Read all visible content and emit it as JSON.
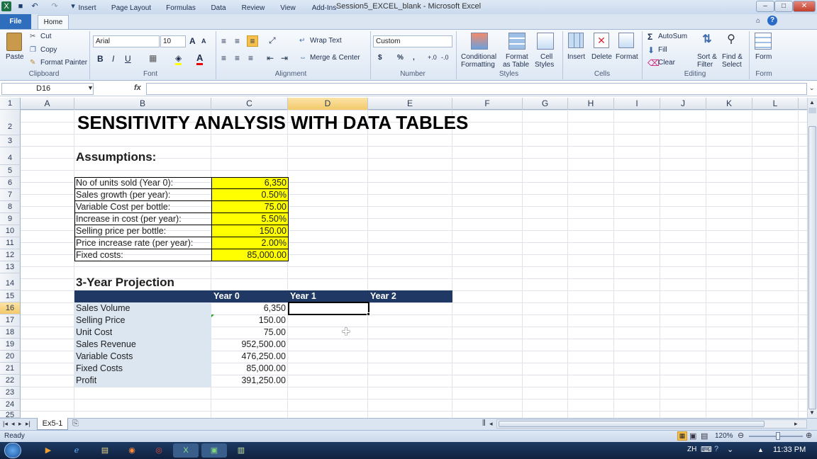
{
  "window": {
    "title": "Session5_EXCEL_blank - Microsoft Excel",
    "min": "–",
    "max": "□",
    "close": "✕"
  },
  "qat": {
    "app": "X",
    "save": "■",
    "undo": "↶",
    "redo": "↷",
    "customize": "▾"
  },
  "tabs": [
    "File",
    "Home",
    "Insert",
    "Page Layout",
    "Formulas",
    "Data",
    "Review",
    "View",
    "Add-Ins"
  ],
  "ribbon": {
    "clipboard": {
      "paste": "Paste",
      "cut": "Cut",
      "copy": "Copy",
      "format_painter": "Format Painter",
      "label": "Clipboard"
    },
    "font": {
      "name": "Arial",
      "size": "10",
      "grow": "A",
      "shrink": "A",
      "bold": "B",
      "italic": "I",
      "underline": "U",
      "label": "Font"
    },
    "alignment": {
      "wrap": "Wrap Text",
      "merge": "Merge & Center",
      "label": "Alignment"
    },
    "number": {
      "format": "Custom",
      "currency": "$",
      "percent": "%",
      "comma": ",",
      "inc": "+.0",
      "dec": "-.0",
      "label": "Number"
    },
    "styles": {
      "conditional": "Conditional",
      "conditional2": "Formatting",
      "format_table": "Format",
      "format_table2": "as Table",
      "cell_styles": "Cell",
      "cell_styles2": "Styles",
      "label": "Styles"
    },
    "cells": {
      "insert": "Insert",
      "delete": "Delete",
      "format": "Format",
      "label": "Cells"
    },
    "editing": {
      "autosum": "AutoSum",
      "fill": "Fill",
      "clear": "Clear",
      "sort": "Sort &",
      "sort2": "Filter",
      "find": "Find &",
      "find2": "Select",
      "label": "Editing"
    },
    "form": {
      "form": "Form",
      "label": "Form"
    }
  },
  "namebox": "D16",
  "fx": "fx",
  "columns": [
    "A",
    "B",
    "C",
    "D",
    "E",
    "F",
    "G",
    "H",
    "I",
    "J",
    "K",
    "L"
  ],
  "rows": [
    "1",
    "2",
    "3",
    "4",
    "5",
    "6",
    "7",
    "8",
    "9",
    "10",
    "11",
    "12",
    "13",
    "14",
    "15",
    "16",
    "17",
    "18",
    "19",
    "20",
    "21",
    "22",
    "23",
    "24",
    "25"
  ],
  "sheet": {
    "title": "SENSITIVITY ANALYSIS WITH DATA TABLES",
    "assumptions_heading": "Assumptions:",
    "assumptions": [
      {
        "label": "No of units sold (Year 0):",
        "value": "6,350"
      },
      {
        "label": "Sales growth (per year):",
        "value": "0.50%"
      },
      {
        "label": "Variable Cost per bottle:",
        "value": "75.00"
      },
      {
        "label": "Increase in cost (per year):",
        "value": "5.50%"
      },
      {
        "label": "Selling price per bottle:",
        "value": "150.00"
      },
      {
        "label": "Price increase rate (per year):",
        "value": "2.00%"
      },
      {
        "label": "Fixed costs:",
        "value": "85,000.00"
      }
    ],
    "projection_heading": "3-Year Projection",
    "projection_headers": [
      "Year 0",
      "Year 1",
      "Year 2"
    ],
    "projection": [
      {
        "label": "Sales Volume",
        "value": "6,350"
      },
      {
        "label": "Selling Price",
        "value": "150.00"
      },
      {
        "label": "Unit Cost",
        "value": "75.00"
      },
      {
        "label": "Sales Revenue",
        "value": "952,500.00"
      },
      {
        "label": "Variable Costs",
        "value": "476,250.00"
      },
      {
        "label": "Fixed Costs",
        "value": "85,000.00"
      },
      {
        "label": "Profit",
        "value": "391,250.00"
      }
    ]
  },
  "sheet_tab": "Ex5-1",
  "status": {
    "ready": "Ready",
    "zoom": "120%"
  },
  "taskbar": {
    "lang": "ZH",
    "time": "11:33 PM"
  },
  "colors": {
    "yellow": "#ffff00",
    "navy": "#1f3864",
    "lightblue": "#dce6f1",
    "selected_col": "#f9d98a"
  }
}
